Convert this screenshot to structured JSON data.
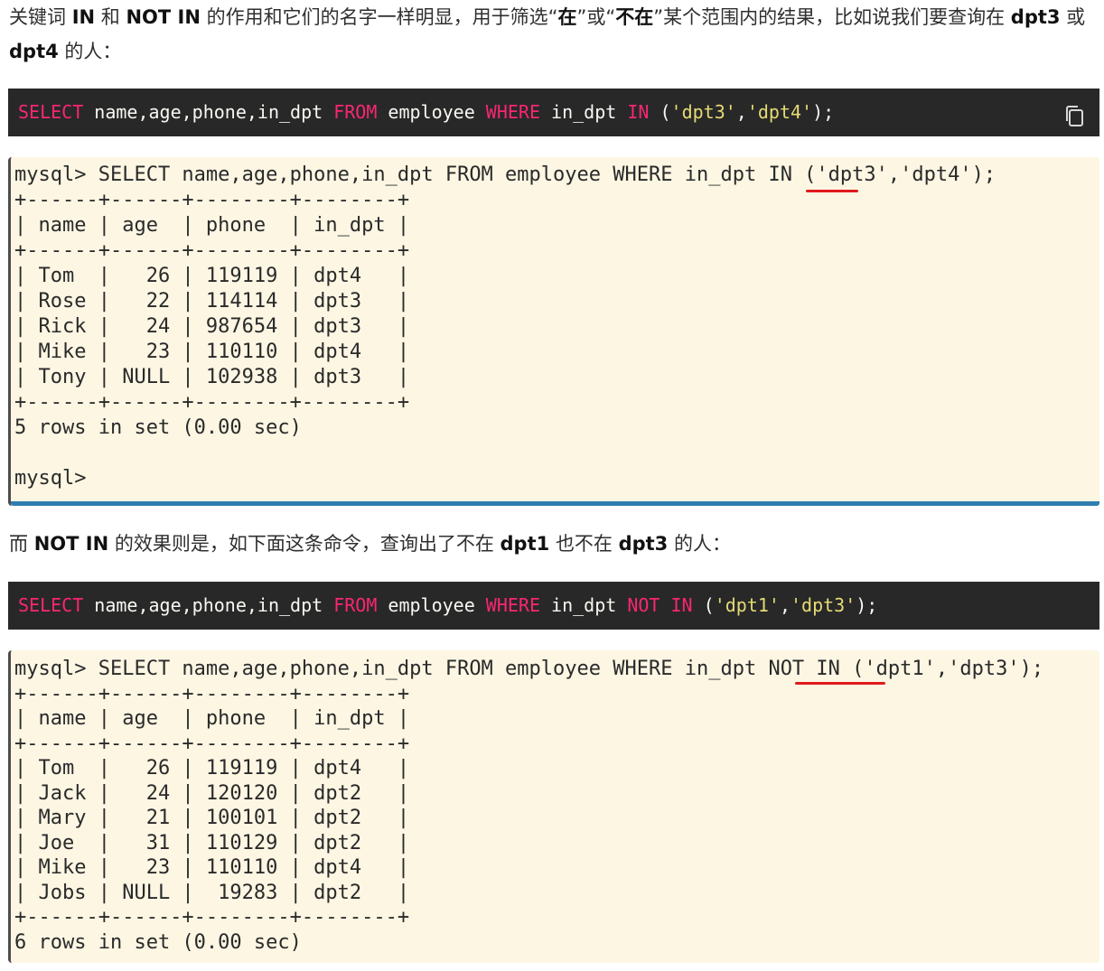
{
  "intro": {
    "t1": "关键词 ",
    "b1": "IN",
    "t2": " 和 ",
    "b2": "NOT IN",
    "t3": " 的作用和它们的名字一样明显，用于筛选“",
    "b3": "在",
    "t4": "”或“",
    "b4": "不在",
    "t5": "”某个范围内的结果，比如说我们要查询在 ",
    "b5": "dpt3",
    "t6": " 或 ",
    "b6": "dpt4",
    "t7": " 的人："
  },
  "code1": {
    "k1": "SELECT",
    "p1": " name,age,phone,in_dpt ",
    "k2": "FROM",
    "p2": " employee ",
    "k3": "WHERE",
    "p3": " in_dpt ",
    "k4": "IN",
    "p4": " (",
    "s1": "'dpt3'",
    "p5": ",",
    "s2": "'dpt4'",
    "p6": ");",
    "copy_icon": "copy-icon"
  },
  "terminal1": {
    "lines": [
      "mysql> SELECT name,age,phone,in_dpt FROM employee WHERE in_dpt IN ('dpt3','dpt4');",
      "+------+------+--------+--------+",
      "| name | age  | phone  | in_dpt |",
      "+------+------+--------+--------+",
      "| Tom  |   26 | 119119 | dpt4   |",
      "| Rose |   22 | 114114 | dpt3   |",
      "| Rick |   24 | 987654 | dpt3   |",
      "| Mike |   23 | 110110 | dpt4   |",
      "| Tony | NULL | 102938 | dpt3   |",
      "+------+------+--------+--------+",
      "5 rows in set (0.00 sec)",
      "",
      "mysql>"
    ],
    "highlight_color": "#e01b1b"
  },
  "middle": {
    "t1": "而 ",
    "b1": "NOT IN",
    "t2": " 的效果则是，如下面这条命令，查询出了不在 ",
    "b2": "dpt1",
    "t3": " 也不在 ",
    "b3": "dpt3",
    "t4": " 的人："
  },
  "code2": {
    "k1": "SELECT",
    "p1": " name,age,phone,in_dpt ",
    "k2": "FROM",
    "p2": " employee ",
    "k3": "WHERE",
    "p3": " in_dpt ",
    "k4": "NOT",
    "p4": " ",
    "k5": "IN",
    "p5": " (",
    "s1": "'dpt1'",
    "p6": ",",
    "s2": "'dpt3'",
    "p7": ");"
  },
  "terminal2": {
    "lines": [
      "mysql> SELECT name,age,phone,in_dpt FROM employee WHERE in_dpt NOT IN ('dpt1','dpt3');",
      "+------+------+--------+--------+",
      "| name | age  | phone  | in_dpt |",
      "+------+------+--------+--------+",
      "| Tom  |   26 | 119119 | dpt4   |",
      "| Jack |   24 | 120120 | dpt2   |",
      "| Mary |   21 | 100101 | dpt2   |",
      "| Joe  |   31 | 110129 | dpt2   |",
      "| Mike |   23 | 110110 | dpt4   |",
      "| Jobs | NULL |  19283 | dpt2   |",
      "+------+------+--------+--------+",
      "6 rows in set (0.00 sec)"
    ]
  }
}
